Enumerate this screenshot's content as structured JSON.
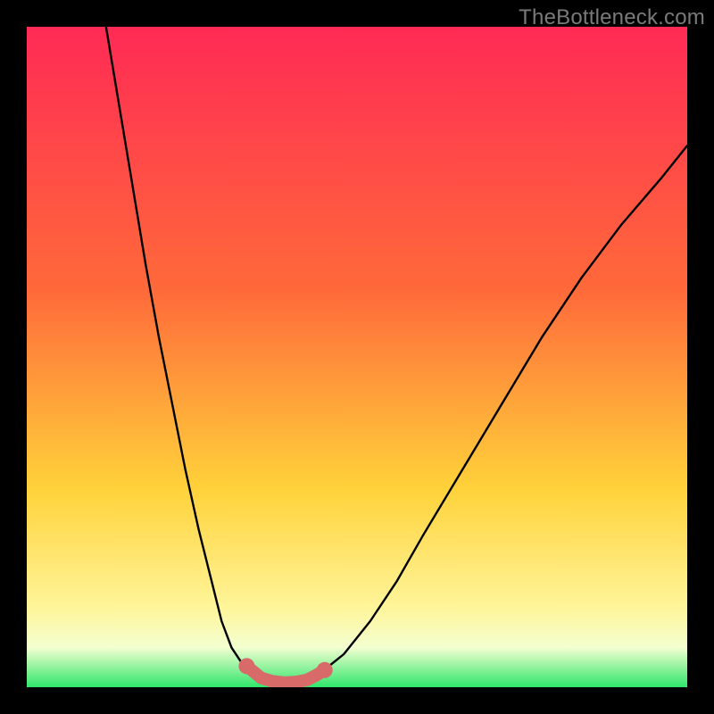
{
  "watermark": "TheBottleneck.com",
  "colors": {
    "bg": "#000000",
    "grad_top": "#ff2a55",
    "grad_upper_mid": "#ff6a3a",
    "grad_mid": "#ffd23a",
    "grad_lower_mid": "#fff59a",
    "grad_pale": "#f3ffd0",
    "grad_green": "#2fe66b",
    "curve_stroke": "#000000",
    "marker_fill": "#d86a6a"
  },
  "chart_data": {
    "type": "line",
    "title": "",
    "xlabel": "",
    "ylabel": "",
    "xlim": [
      0,
      100
    ],
    "ylim": [
      0,
      100
    ],
    "series": [
      {
        "name": "left-arm",
        "x": [
          12,
          14,
          16,
          18,
          20,
          22,
          24,
          26,
          28,
          29.5,
          31,
          33,
          35
        ],
        "values": [
          100,
          88,
          76,
          64,
          53,
          43,
          33,
          24,
          16,
          10,
          6,
          3,
          1.5
        ]
      },
      {
        "name": "valley-floor",
        "x": [
          35,
          36.5,
          38,
          39.5,
          41,
          42.5,
          44
        ],
        "values": [
          1.5,
          0.9,
          0.7,
          0.7,
          0.8,
          1.1,
          1.8
        ]
      },
      {
        "name": "right-arm",
        "x": [
          44,
          48,
          52,
          56,
          60,
          66,
          72,
          78,
          84,
          90,
          96,
          100
        ],
        "values": [
          1.8,
          5,
          10,
          16,
          23,
          33,
          43,
          53,
          62,
          70,
          77,
          82
        ]
      }
    ],
    "markers": {
      "name": "bottom-nodes",
      "points": [
        {
          "x": 33.3,
          "y": 3.2
        },
        {
          "x": 35.5,
          "y": 1.4
        },
        {
          "x": 37.2,
          "y": 0.9
        },
        {
          "x": 39.0,
          "y": 0.7
        },
        {
          "x": 40.8,
          "y": 0.8
        },
        {
          "x": 42.4,
          "y": 1.1
        },
        {
          "x": 43.8,
          "y": 1.8
        },
        {
          "x": 45.1,
          "y": 2.6
        }
      ],
      "radius_base": 7
    },
    "gradient_stops": [
      {
        "offset": 0,
        "color_key": "grad_top"
      },
      {
        "offset": 40,
        "color_key": "grad_upper_mid"
      },
      {
        "offset": 70,
        "color_key": "grad_mid"
      },
      {
        "offset": 88,
        "color_key": "grad_lower_mid"
      },
      {
        "offset": 94,
        "color_key": "grad_pale"
      },
      {
        "offset": 100,
        "color_key": "grad_green"
      }
    ]
  }
}
